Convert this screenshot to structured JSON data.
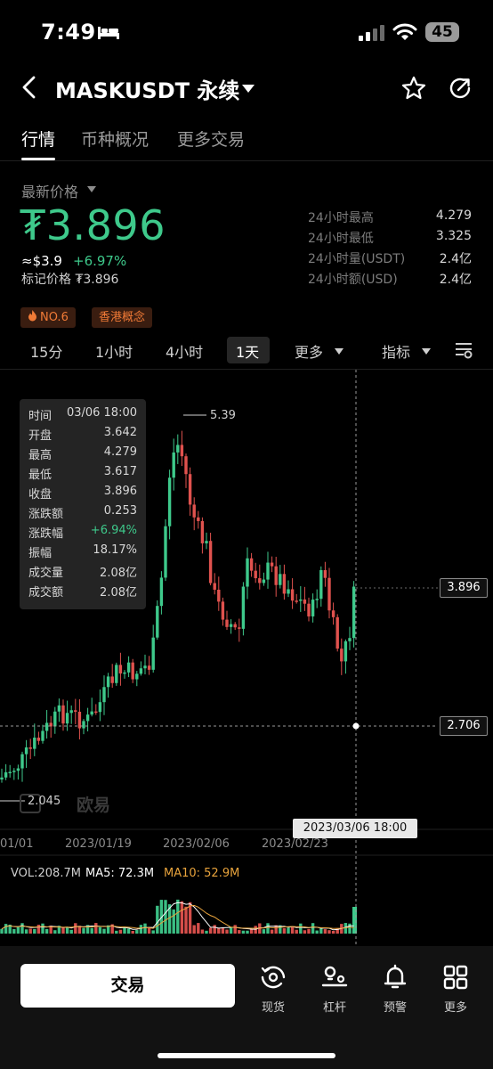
{
  "status_bar": {
    "time": "7:49",
    "battery": "45"
  },
  "header": {
    "title": "MASKUSDT 永续"
  },
  "tabs": [
    {
      "label": "行情"
    },
    {
      "label": "币种概况"
    },
    {
      "label": "更多交易"
    }
  ],
  "price": {
    "label": "最新价格",
    "value": "₮3.896",
    "approx_usd": "≈$3.9",
    "change_pct": "+6.97%",
    "mark_price": "标记价格 ₮3.896"
  },
  "stats": [
    {
      "label": "24小时最高",
      "value": "4.279"
    },
    {
      "label": "24小时最低",
      "value": "3.325"
    },
    {
      "label": "24小时量(USDT)",
      "value": "2.4亿"
    },
    {
      "label": "24小时额(USD)",
      "value": "2.4亿"
    }
  ],
  "tags": [
    {
      "label": "NO.6"
    },
    {
      "label": "香港概念"
    }
  ],
  "intervals": [
    {
      "label": "15分"
    },
    {
      "label": "1小时"
    },
    {
      "label": "4小时"
    },
    {
      "label": "1天"
    },
    {
      "label": "更多"
    }
  ],
  "indicator_label": "指标",
  "tooltip": [
    {
      "label": "时间",
      "value": "03/06 18:00"
    },
    {
      "label": "开盘",
      "value": "3.642"
    },
    {
      "label": "最高",
      "value": "4.279"
    },
    {
      "label": "最低",
      "value": "3.617"
    },
    {
      "label": "收盘",
      "value": "3.896"
    },
    {
      "label": "涨跌额",
      "value": "0.253"
    },
    {
      "label": "涨跌幅",
      "value": "+6.94%"
    },
    {
      "label": "振幅",
      "value": "18.17%"
    },
    {
      "label": "成交量",
      "value": "2.08亿"
    },
    {
      "label": "成交额",
      "value": "2.08亿"
    }
  ],
  "chart_data": {
    "type": "candlestick",
    "high_label": "5.39",
    "low_label": "2.045",
    "current_price_tag": "3.896",
    "crosshair_price_tag": "2.706",
    "crosshair_date": "2023/03/06 18:00",
    "x_ticks": [
      "01/01",
      "2023/01/19",
      "2023/02/06",
      "2023/02/23"
    ],
    "volume": {
      "vol": "VOL:208.7M",
      "ma5": "MA5: 72.3M",
      "ma10": "MA10: 52.9M"
    },
    "colors": {
      "up": "#3ec98b",
      "down": "#e0524e",
      "ma5": "#ffffff",
      "ma10": "#e8a33c"
    }
  },
  "watermark": "欧易",
  "bottom_nav": {
    "trade_button": "交易",
    "items": [
      {
        "label": "现货"
      },
      {
        "label": "杠杆"
      },
      {
        "label": "预警"
      },
      {
        "label": "更多"
      }
    ]
  }
}
